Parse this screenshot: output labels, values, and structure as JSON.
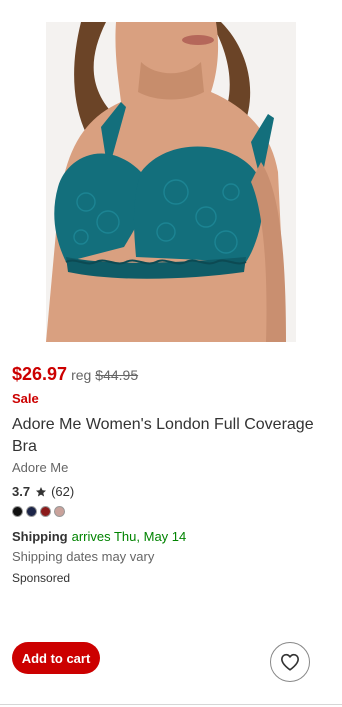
{
  "product": {
    "image_alt": "Adore Me Women's London Full Coverage Bra in teal lace",
    "sale_price": "$26.97",
    "reg_label": "reg",
    "reg_price": "$44.95",
    "sale_badge": "Sale",
    "title": "Adore Me Women's London Full Coverage Bra",
    "brand": "Adore Me",
    "rating": "3.7",
    "review_count": "(62)",
    "swatches": [
      {
        "color": "#111111",
        "icon": "black-swatch"
      },
      {
        "color": "#1c2548",
        "icon": "navy-swatch"
      },
      {
        "color": "#8b1a1a",
        "icon": "burgundy-swatch"
      },
      {
        "color": "#c9a29b",
        "icon": "nude-swatch"
      }
    ],
    "product_color": "#136f7c"
  },
  "shipping": {
    "label": "Shipping",
    "arrival": "arrives Thu, May 14",
    "note": "Shipping dates may vary"
  },
  "sponsored": "Sponsored",
  "actions": {
    "add_to_cart": "Add to cart",
    "wishlist_icon": "heart-icon"
  },
  "colors": {
    "accent": "#cc0000",
    "shipping_green": "#008300"
  }
}
